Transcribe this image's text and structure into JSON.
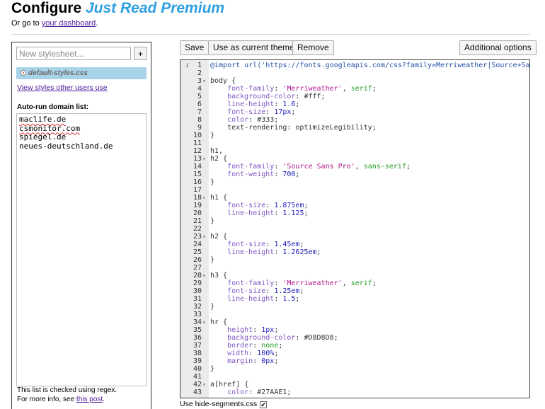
{
  "header": {
    "title_prefix": "Configure",
    "title_brand": "Just Read Premium",
    "subline_prefix": "Or go to ",
    "dashboard_link": "your dashboard",
    "subline_suffix": "."
  },
  "sidebar": {
    "new_placeholder": "New stylesheet...",
    "add_label": "+",
    "stylesheets": [
      {
        "name": "default-styles.css",
        "selected": true
      }
    ],
    "view_styles_link": "View styles other users use",
    "domain_label": "Auto-run domain list:",
    "domains": [
      "maclife.de",
      "csmonitor.com",
      "spiegel.de",
      "neues-deutschland.de"
    ],
    "footnote_line1": "This list is checked using regex.",
    "footnote_line2_prefix": "For more info, see ",
    "footnote_link": "this post",
    "footnote_line2_suffix": "."
  },
  "toolbar": {
    "save_label": "Save",
    "use_theme_label": "Use as current theme",
    "remove_label": "Remove",
    "additional_label": "Additional options"
  },
  "editor": {
    "lines": [
      {
        "n": "1",
        "fold": false,
        "info": true,
        "tokens": [
          {
            "t": "@import url('https://fonts.googleapis.com/css?family=Merriweather|Source+Sans",
            "c": "url"
          }
        ]
      },
      {
        "n": "2",
        "fold": false,
        "tokens": []
      },
      {
        "n": "3",
        "fold": true,
        "tokens": [
          {
            "t": "body {",
            "c": ""
          }
        ]
      },
      {
        "n": "4",
        "fold": false,
        "tokens": [
          {
            "t": "    font-family",
            "c": "prop"
          },
          {
            "t": ": ",
            "c": ""
          },
          {
            "t": "'Merriweather'",
            "c": "str"
          },
          {
            "t": ", ",
            "c": ""
          },
          {
            "t": "serif",
            "c": "kw"
          },
          {
            "t": ";",
            "c": ""
          }
        ]
      },
      {
        "n": "5",
        "fold": false,
        "tokens": [
          {
            "t": "    background-color",
            "c": "prop"
          },
          {
            "t": ": #fff;",
            "c": ""
          }
        ]
      },
      {
        "n": "6",
        "fold": false,
        "tokens": [
          {
            "t": "    line-height",
            "c": "prop"
          },
          {
            "t": ": ",
            "c": ""
          },
          {
            "t": "1.6",
            "c": "num"
          },
          {
            "t": ";",
            "c": ""
          }
        ]
      },
      {
        "n": "7",
        "fold": false,
        "tokens": [
          {
            "t": "    font-size",
            "c": "prop"
          },
          {
            "t": ": ",
            "c": ""
          },
          {
            "t": "17px",
            "c": "num"
          },
          {
            "t": ";",
            "c": ""
          }
        ]
      },
      {
        "n": "8",
        "fold": false,
        "tokens": [
          {
            "t": "    color",
            "c": "prop"
          },
          {
            "t": ": #333;",
            "c": ""
          }
        ]
      },
      {
        "n": "9",
        "fold": false,
        "tokens": [
          {
            "t": "    text-rendering: optimizeLegibility;",
            "c": ""
          }
        ]
      },
      {
        "n": "10",
        "fold": false,
        "tokens": [
          {
            "t": "}",
            "c": ""
          }
        ]
      },
      {
        "n": "11",
        "fold": false,
        "tokens": []
      },
      {
        "n": "12",
        "fold": false,
        "tokens": [
          {
            "t": "h1,",
            "c": ""
          }
        ]
      },
      {
        "n": "13",
        "fold": true,
        "tokens": [
          {
            "t": "h2 {",
            "c": ""
          }
        ]
      },
      {
        "n": "14",
        "fold": false,
        "tokens": [
          {
            "t": "    font-family",
            "c": "prop"
          },
          {
            "t": ": ",
            "c": ""
          },
          {
            "t": "'Source Sans Pro'",
            "c": "str"
          },
          {
            "t": ", ",
            "c": ""
          },
          {
            "t": "sans-serif",
            "c": "kw"
          },
          {
            "t": ";",
            "c": ""
          }
        ]
      },
      {
        "n": "15",
        "fold": false,
        "tokens": [
          {
            "t": "    font-weight",
            "c": "prop"
          },
          {
            "t": ": ",
            "c": ""
          },
          {
            "t": "700",
            "c": "num"
          },
          {
            "t": ";",
            "c": ""
          }
        ]
      },
      {
        "n": "16",
        "fold": false,
        "tokens": [
          {
            "t": "}",
            "c": ""
          }
        ]
      },
      {
        "n": "17",
        "fold": false,
        "tokens": []
      },
      {
        "n": "18",
        "fold": true,
        "tokens": [
          {
            "t": "h1 {",
            "c": ""
          }
        ]
      },
      {
        "n": "19",
        "fold": false,
        "tokens": [
          {
            "t": "    font-size",
            "c": "prop"
          },
          {
            "t": ": ",
            "c": ""
          },
          {
            "t": "1.875em",
            "c": "num"
          },
          {
            "t": ";",
            "c": ""
          }
        ]
      },
      {
        "n": "20",
        "fold": false,
        "tokens": [
          {
            "t": "    line-height",
            "c": "prop"
          },
          {
            "t": ": ",
            "c": ""
          },
          {
            "t": "1.125",
            "c": "num"
          },
          {
            "t": ";",
            "c": ""
          }
        ]
      },
      {
        "n": "21",
        "fold": false,
        "tokens": [
          {
            "t": "}",
            "c": ""
          }
        ]
      },
      {
        "n": "22",
        "fold": false,
        "tokens": []
      },
      {
        "n": "23",
        "fold": true,
        "tokens": [
          {
            "t": "h2 {",
            "c": ""
          }
        ]
      },
      {
        "n": "24",
        "fold": false,
        "tokens": [
          {
            "t": "    font-size",
            "c": "prop"
          },
          {
            "t": ": ",
            "c": ""
          },
          {
            "t": "1.45em",
            "c": "num"
          },
          {
            "t": ";",
            "c": ""
          }
        ]
      },
      {
        "n": "25",
        "fold": false,
        "tokens": [
          {
            "t": "    line-height",
            "c": "prop"
          },
          {
            "t": ": ",
            "c": ""
          },
          {
            "t": "1.2625em",
            "c": "num"
          },
          {
            "t": ";",
            "c": ""
          }
        ]
      },
      {
        "n": "26",
        "fold": false,
        "tokens": [
          {
            "t": "}",
            "c": ""
          }
        ]
      },
      {
        "n": "27",
        "fold": false,
        "tokens": []
      },
      {
        "n": "28",
        "fold": true,
        "tokens": [
          {
            "t": "h3 {",
            "c": ""
          }
        ]
      },
      {
        "n": "29",
        "fold": false,
        "tokens": [
          {
            "t": "    font-family",
            "c": "prop"
          },
          {
            "t": ": ",
            "c": ""
          },
          {
            "t": "'Merriweather'",
            "c": "str"
          },
          {
            "t": ", ",
            "c": ""
          },
          {
            "t": "serif",
            "c": "kw"
          },
          {
            "t": ";",
            "c": ""
          }
        ]
      },
      {
        "n": "30",
        "fold": false,
        "tokens": [
          {
            "t": "    font-size",
            "c": "prop"
          },
          {
            "t": ": ",
            "c": ""
          },
          {
            "t": "1.25em",
            "c": "num"
          },
          {
            "t": ";",
            "c": ""
          }
        ]
      },
      {
        "n": "31",
        "fold": false,
        "tokens": [
          {
            "t": "    line-height",
            "c": "prop"
          },
          {
            "t": ": ",
            "c": ""
          },
          {
            "t": "1.5",
            "c": "num"
          },
          {
            "t": ";",
            "c": ""
          }
        ]
      },
      {
        "n": "32",
        "fold": false,
        "tokens": [
          {
            "t": "}",
            "c": ""
          }
        ]
      },
      {
        "n": "33",
        "fold": false,
        "tokens": []
      },
      {
        "n": "34",
        "fold": true,
        "tokens": [
          {
            "t": "hr {",
            "c": ""
          }
        ]
      },
      {
        "n": "35",
        "fold": false,
        "tokens": [
          {
            "t": "    height",
            "c": "prop"
          },
          {
            "t": ": ",
            "c": ""
          },
          {
            "t": "1px",
            "c": "num"
          },
          {
            "t": ";",
            "c": ""
          }
        ]
      },
      {
        "n": "36",
        "fold": false,
        "tokens": [
          {
            "t": "    background-color",
            "c": "prop"
          },
          {
            "t": ": #D8D8D8;",
            "c": ""
          }
        ]
      },
      {
        "n": "37",
        "fold": false,
        "tokens": [
          {
            "t": "    border",
            "c": "prop"
          },
          {
            "t": ": ",
            "c": ""
          },
          {
            "t": "none",
            "c": "kw"
          },
          {
            "t": ";",
            "c": ""
          }
        ]
      },
      {
        "n": "38",
        "fold": false,
        "tokens": [
          {
            "t": "    width",
            "c": "prop"
          },
          {
            "t": ": ",
            "c": ""
          },
          {
            "t": "100%",
            "c": "num"
          },
          {
            "t": ";",
            "c": ""
          }
        ]
      },
      {
        "n": "39",
        "fold": false,
        "tokens": [
          {
            "t": "    margin",
            "c": "prop"
          },
          {
            "t": ": ",
            "c": ""
          },
          {
            "t": "0px",
            "c": "num"
          },
          {
            "t": ";",
            "c": ""
          }
        ]
      },
      {
        "n": "40",
        "fold": false,
        "tokens": [
          {
            "t": "}",
            "c": ""
          }
        ]
      },
      {
        "n": "41",
        "fold": false,
        "tokens": []
      },
      {
        "n": "42",
        "fold": true,
        "tokens": [
          {
            "t": "a[href] {",
            "c": ""
          }
        ]
      },
      {
        "n": "43",
        "fold": false,
        "tokens": [
          {
            "t": "    color",
            "c": "prop"
          },
          {
            "t": ": #27AAE1;",
            "c": ""
          }
        ]
      }
    ]
  },
  "footer": {
    "hide_segments_label": "Use hide-segments.css",
    "hide_segments_checked": true
  },
  "colors": {
    "brand": "#2e9fe0",
    "link": "#4b1b9b",
    "selected_item_bg": "#a9d3e8",
    "gutter_bg": "#ebebeb"
  }
}
